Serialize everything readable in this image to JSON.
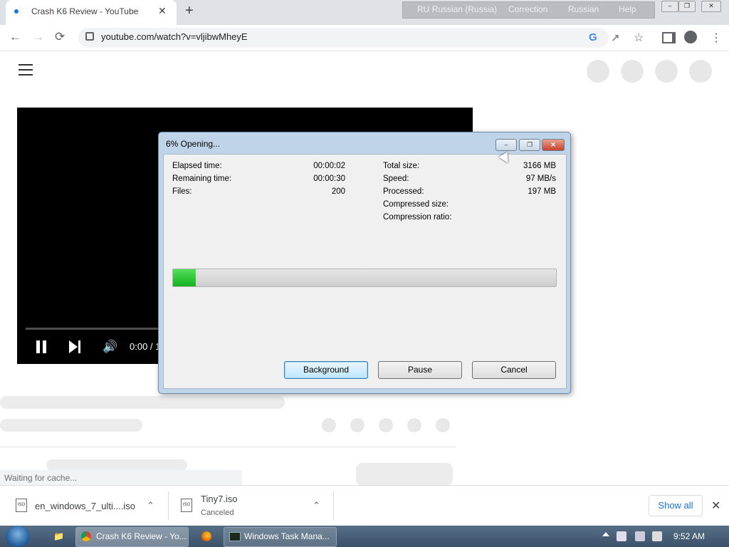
{
  "browser": {
    "tab_title": "Crash K6 Review - YouTube",
    "new_tab": "+",
    "close_tab": "✕",
    "url": "youtube.com/watch?v=vljibwMheyE"
  },
  "langbar": {
    "language": "RU Russian (Russia)",
    "correction": "Correction",
    "keyboard": "Russian",
    "help": "Help"
  },
  "window_controls": {
    "min": "–",
    "max": "❐",
    "close": "✕"
  },
  "video": {
    "time": "0:00 / 1"
  },
  "status_bar": {
    "text": "Waiting for cache..."
  },
  "downloads": {
    "items": [
      {
        "name": "en_windows_7_ulti....iso",
        "status": ""
      },
      {
        "name": "Tiny7.iso",
        "status": "Canceled"
      }
    ],
    "show_all": "Show all"
  },
  "dialog": {
    "title": "6% Opening...",
    "progress_percent": 6,
    "left_labels": [
      "Elapsed time:",
      "Remaining time:",
      "Files:"
    ],
    "left_values": [
      "00:00:02",
      "00:00:30",
      "200"
    ],
    "right_labels": [
      "Total size:",
      "Speed:",
      "Processed:",
      "Compressed size:",
      "Compression ratio:"
    ],
    "right_values": [
      "3166 MB",
      "97 MB/s",
      "197 MB",
      "",
      ""
    ],
    "buttons": {
      "background": "Background",
      "pause": "Pause",
      "cancel": "Cancel"
    }
  },
  "taskbar": {
    "items": [
      "Crash K6 Review - Yo...",
      "Windows Task Mana..."
    ],
    "clock": "9:52 AM"
  },
  "icons": [
    "back-icon",
    "forward-icon",
    "stop-icon",
    "lock-icon",
    "google-icon",
    "share-icon",
    "star-icon",
    "sidepanel-icon",
    "profile-icon",
    "menu-icon",
    "hamburger-icon",
    "pause-icon",
    "next-icon",
    "volume-icon",
    "iso-file-icon",
    "chevron-up-icon",
    "close-icon",
    "start-orb-icon",
    "explorer-icon",
    "chrome-icon",
    "firefox-icon",
    "taskmgr-icon"
  ],
  "colors": {
    "progress_fill": "#15b01f",
    "link": "#1a73e8"
  }
}
